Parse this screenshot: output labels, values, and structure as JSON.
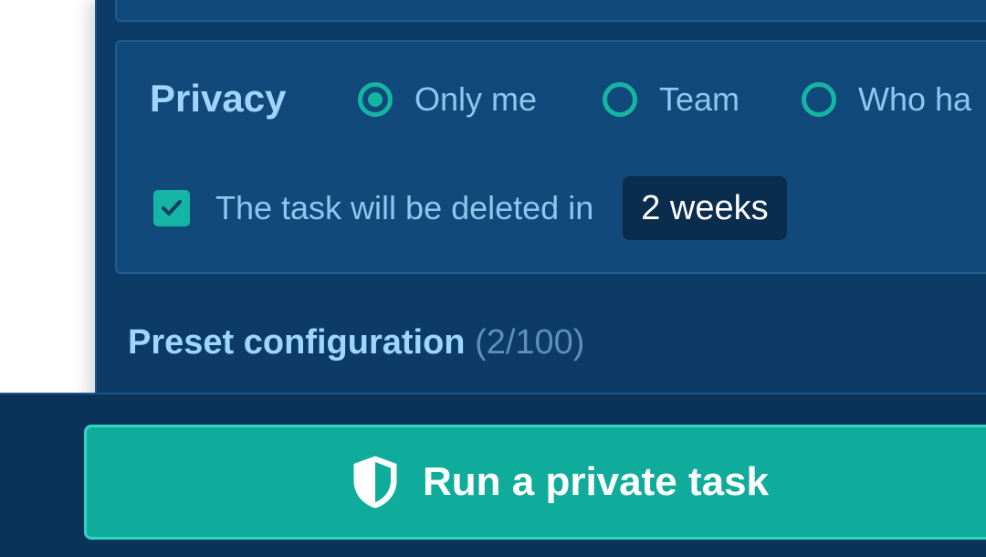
{
  "privacy": {
    "label": "Privacy",
    "options": [
      {
        "label": "Only me",
        "selected": true
      },
      {
        "label": "Team",
        "selected": false
      },
      {
        "label": "Who ha",
        "selected": false
      }
    ]
  },
  "deletion": {
    "checked": true,
    "text": "The task will be deleted in",
    "duration": "2 weeks"
  },
  "preset": {
    "label": "Preset configuration",
    "count": "(2/100)"
  },
  "run_button": {
    "label": "Run a private task",
    "icon": "shield-icon"
  },
  "colors": {
    "panel": "#0b3b66",
    "card": "#11497a",
    "accent": "#15b5a4",
    "button": "#10ac9b",
    "text_primary": "#9fd6ff",
    "text_muted": "#5c8fb9"
  }
}
